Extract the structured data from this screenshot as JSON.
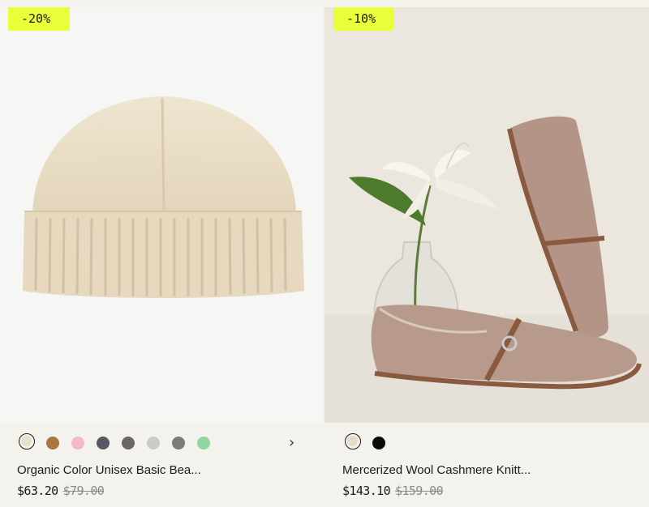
{
  "products": [
    {
      "discount": "-20%",
      "title": "Organic Color Unisex Basic Bea...",
      "price": "$63.20",
      "original_price": "$79.00",
      "swatches": [
        "#e9dfcc",
        "#a8773f",
        "#f4b9c8",
        "#555a62",
        "#6e6560",
        "#c9ccc8",
        "#7a7b7d",
        "#8fd6a0"
      ],
      "selected_swatch": 0
    },
    {
      "discount": "-10%",
      "title": "Mercerized Wool Cashmere Knitt...",
      "price": "$143.10",
      "original_price": "$159.00",
      "swatches": [
        "#e7dccb",
        "#0a0a0a"
      ],
      "selected_swatch": 0
    }
  ],
  "icons": {
    "next": "chevron-right-icon"
  },
  "colors": {
    "badge": "#e8ff3a",
    "page_bg": "#f3f2ec"
  }
}
